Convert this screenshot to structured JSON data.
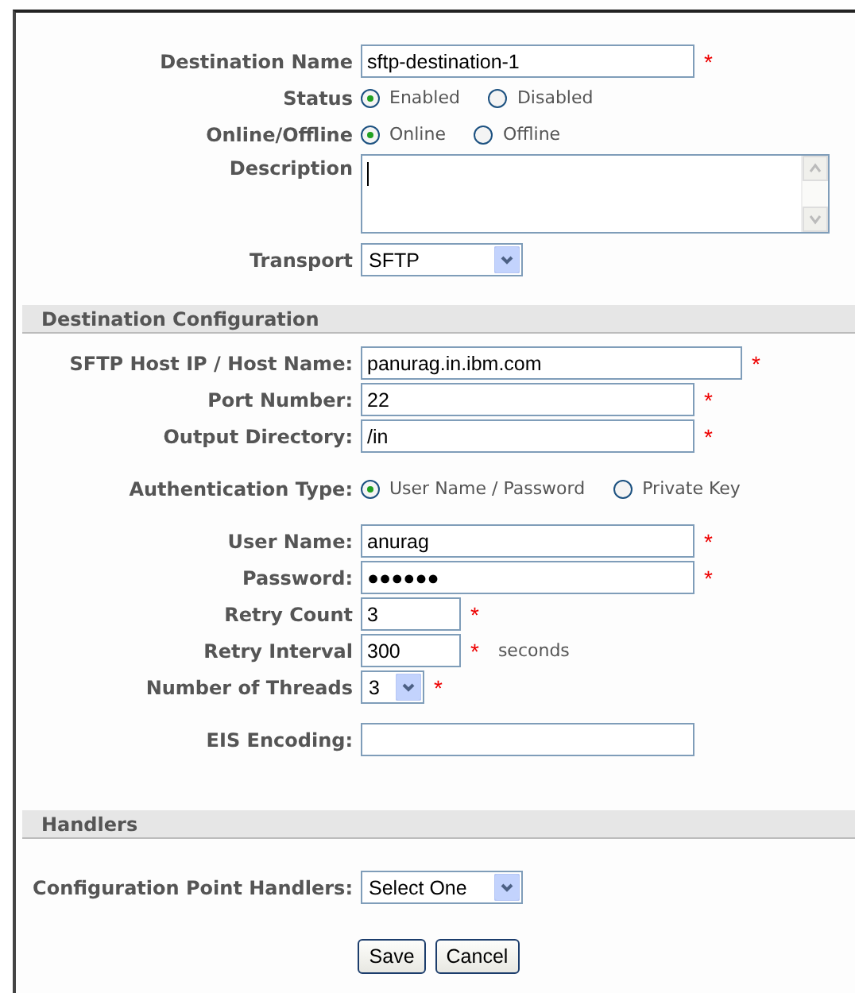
{
  "sections": [
    {
      "groups": [
        [
          {
            "kind": "text",
            "label": "Destination Name",
            "value": "sftp-destination-1",
            "mark": "*"
          },
          {
            "kind": "radio",
            "label": "Status",
            "options": [
              {
                "label": "Enabled",
                "selected": true
              },
              {
                "label": "Disabled",
                "selected": false
              }
            ]
          },
          {
            "kind": "radio",
            "label": "Online/Offline",
            "options": [
              {
                "label": "Online",
                "selected": true
              },
              {
                "label": "Offline",
                "selected": false
              }
            ]
          },
          {
            "kind": "textarea",
            "label": "Description"
          },
          {
            "kind": "select",
            "label": "Transport",
            "value": "SFTP"
          }
        ]
      ]
    },
    {
      "heading": "Destination Configuration",
      "groups": [
        [
          {
            "kind": "widetext",
            "label": "SFTP Host IP / Host Name:",
            "value": "panurag.in.ibm.com",
            "mark": "*"
          },
          {
            "kind": "text",
            "label": "Port Number:",
            "value": "22",
            "mark": "*"
          },
          {
            "kind": "text",
            "label": "Output Directory:",
            "value": "/in",
            "mark": "*"
          }
        ],
        [
          {
            "kind": "radio",
            "label": "Authentication Type:",
            "options": [
              {
                "label": "User Name / Password",
                "selected": true
              },
              {
                "label": "Private Key",
                "selected": false
              }
            ]
          }
        ],
        [
          {
            "kind": "text",
            "label": "User Name:",
            "value": "anurag",
            "mark": "*"
          },
          {
            "kind": "text",
            "label": "Password:",
            "value": "●●●●●●",
            "mark": "*"
          },
          {
            "kind": "shorttext",
            "label": "Retry Count",
            "value": "3",
            "mark": "*"
          },
          {
            "kind": "shorttext",
            "label": "Retry Interval",
            "value": "300",
            "mark": "*",
            "note": "seconds"
          },
          {
            "kind": "shortselect",
            "label": "Number of Threads",
            "value": "3",
            "mark": "*"
          }
        ],
        [
          {
            "kind": "text",
            "label": "EIS Encoding:"
          }
        ]
      ]
    },
    {
      "heading": "Handlers",
      "groups": [
        [
          {
            "kind": "select",
            "label": "Configuration Point Handlers:",
            "value": "Select One"
          }
        ]
      ]
    }
  ],
  "buttons": [
    "Save",
    "Cancel"
  ]
}
